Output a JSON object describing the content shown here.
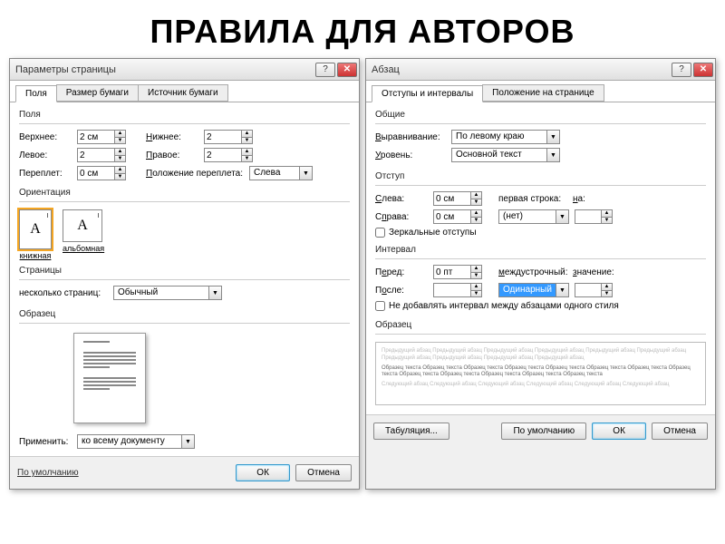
{
  "title": "ПРАВИЛА ДЛЯ АВТОРОВ",
  "page_setup": {
    "title": "Параметры страницы",
    "tabs": [
      "Поля",
      "Размер бумаги",
      "Источник бумаги"
    ],
    "polya_label": "Поля",
    "top_label": "Верхнее:",
    "bottom_label": "Нижнее:",
    "left_label": "Левое:",
    "right_label": "Правое:",
    "gutter_label": "Переплет:",
    "gutter_pos_label": "Положение переплета:",
    "top": "2 см",
    "bottom": "2",
    "left": "2",
    "right": "2",
    "gutter": "0 см",
    "gutter_pos": "Слева",
    "orient_label": "Ориентация",
    "orient_portrait": "книжная",
    "orient_landscape": "альбомная",
    "pages_label": "Страницы",
    "multi_pages_label": "несколько страниц:",
    "multi_pages": "Обычный",
    "sample_label": "Образец",
    "apply_label": "Применить:",
    "apply": "ко всему документу",
    "default_btn": "По умолчанию",
    "ok_btn": "ОК",
    "cancel_btn": "Отмена",
    "help": "?",
    "close": "✕"
  },
  "paragraph": {
    "title": "Абзац",
    "tabs": [
      "Отступы и интервалы",
      "Положение на странице"
    ],
    "general_label": "Общие",
    "align_label": "Выравнивание:",
    "align": "По левому краю",
    "level_label": "Уровень:",
    "level": "Основной текст",
    "indent_label": "Отступ",
    "left_label": "Слева:",
    "right_label": "Справа:",
    "left": "0 см",
    "right": "0 см",
    "first_line_label": "первая строка:",
    "first_line": "(нет)",
    "on_label": "на:",
    "on_value": "",
    "mirror_label": "Зеркальные отступы",
    "interval_label": "Интервал",
    "before_label": "Перед:",
    "after_label": "После:",
    "before": "0 пт",
    "after": "",
    "spacing_label": "междустрочный:",
    "spacing": "Одинарный",
    "value_label": "значение:",
    "value": "",
    "no_space_label": "Не добавлять интервал между абзацами одного стиля",
    "sample_label": "Образец",
    "sample_prev": "Предыдущий абзац Предыдущий абзац Предыдущий абзац Предыдущий абзац Предыдущий абзац Предыдущий абзац Предыдущий абзац Предыдущий абзац Предыдущий абзац Предыдущий абзац",
    "sample_cur": "Образец текста Образец текста Образец текста Образец текста Образец текста Образец текста Образец текста Образец текста Образец текста Образец текста Образец текста Образец текста Образец текста",
    "sample_next": "Следующий абзац Следующий абзац Следующий абзац Следующий абзац Следующий абзац Следующий абзац",
    "tabs_btn": "Табуляция...",
    "default_btn": "По умолчанию",
    "ok_btn": "ОК",
    "cancel_btn": "Отмена",
    "help": "?",
    "close": "✕"
  }
}
